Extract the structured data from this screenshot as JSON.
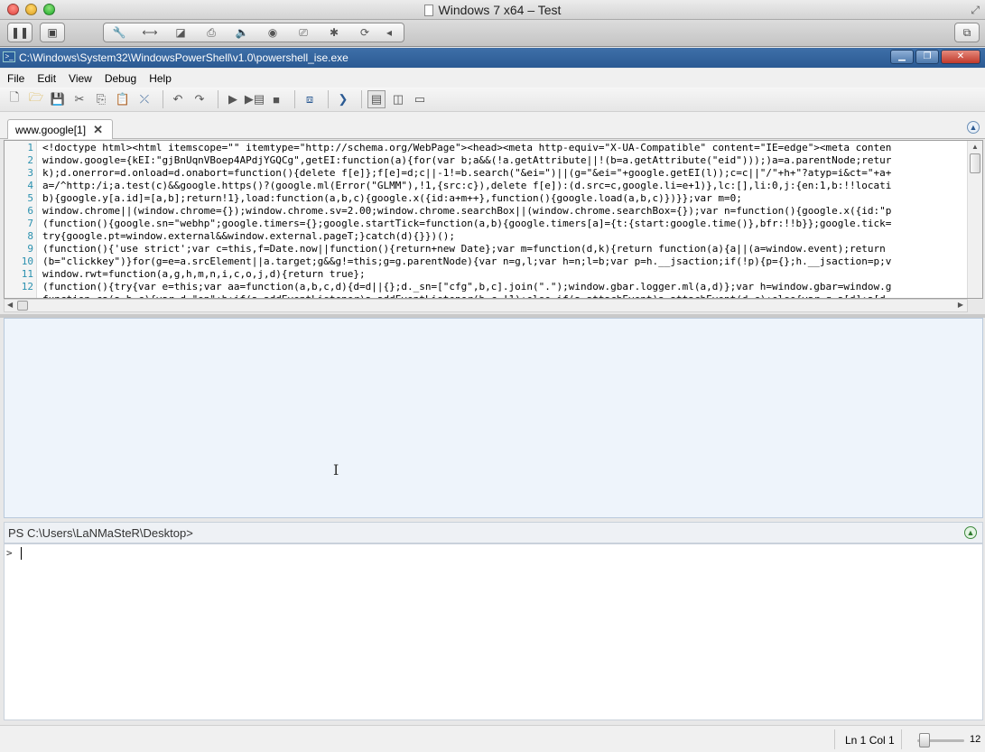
{
  "mac_window": {
    "title": "Windows 7 x64 – Test"
  },
  "vm_toolbar": {
    "pause_icon": "pause-icon",
    "snapshot_icon": "snapshot-icon",
    "icons": [
      "wrench-icon",
      "network-icon",
      "disk-icon",
      "printer-icon",
      "speaker-icon",
      "camera-icon",
      "usb-icon",
      "bluetooth-icon",
      "sync-icon",
      "chevron-left-icon"
    ],
    "fullscreen_icon": "fullscreen-icon"
  },
  "app_window": {
    "title": "C:\\Windows\\System32\\WindowsPowerShell\\v1.0\\powershell_ise.exe"
  },
  "menu": {
    "file": "File",
    "edit": "Edit",
    "view": "View",
    "debug": "Debug",
    "help": "Help"
  },
  "script_tabs": [
    {
      "label": "www.google[1]"
    }
  ],
  "editor": {
    "lines": [
      {
        "num": "1",
        "text": "<!doctype html><html itemscope=\"\" itemtype=\"http://schema.org/WebPage\"><head><meta http-equiv=\"X-UA-Compatible\" content=\"IE=edge\"><meta conten"
      },
      {
        "num": "2",
        "text": "window.google={kEI:\"gjBnUqnVBoep4APdjYGQCg\",getEI:function(a){for(var b;a&&(!a.getAttribute||!(b=a.getAttribute(\"eid\")));)a=a.parentNode;retur"
      },
      {
        "num": "3",
        "text": "k);d.onerror=d.onload=d.onabort=function(){delete f[e]};f[e]=d;c||-1!=b.search(\"&ei=\")||(g=\"&ei=\"+google.getEI(l));c=c||\"/\"+h+\"?atyp=i&ct=\"+a+"
      },
      {
        "num": "4",
        "text": "a=/^http:/i;a.test(c)&&google.https()?(google.ml(Error(\"GLMM\"),!1,{src:c}),delete f[e]):(d.src=c,google.li=e+1)},lc:[],li:0,j:{en:1,b:!!locati"
      },
      {
        "num": "5",
        "text": "b){google.y[a.id]=[a,b];return!1},load:function(a,b,c){google.x({id:a+m++},function(){google.load(a,b,c)})}};var m=0;"
      },
      {
        "num": "6",
        "text": "window.chrome||(window.chrome={});window.chrome.sv=2.00;window.chrome.searchBox||(window.chrome.searchBox={});var n=function(){google.x({id:\"p"
      },
      {
        "num": "7",
        "text": "(function(){google.sn=\"webhp\";google.timers={};google.startTick=function(a,b){google.timers[a]={t:{start:google.time()},bfr:!!b}};google.tick="
      },
      {
        "num": "8",
        "text": "try{google.pt=window.external&&window.external.pageT;}catch(d){}})();"
      },
      {
        "num": "9",
        "text": "(function(){'use strict';var c=this,f=Date.now||function(){return+new Date};var m=function(d,k){return function(a){a||(a=window.event);return "
      },
      {
        "num": "10",
        "text": "(b=\"clickkey\")}for(g=e=a.srcElement||a.target;g&&g!=this;g=g.parentNode){var n=g,l;var h=n;l=b;var p=h.__jsaction;if(!p){p={};h.__jsaction=p;v"
      },
      {
        "num": "11",
        "text": "window.rwt=function(a,g,h,m,n,i,c,o,j,d){return true};"
      },
      {
        "num": "12",
        "text": "(function(){try{var e=this;var aa=function(a,b,c,d){d=d||{};d._sn=[\"cfg\",b,c].join(\".\");window.gbar.logger.ml(a,d)};var h=window.gbar=window.g"
      },
      {
        "num": "",
        "text": "function ca(a,b,c){var d=\"on\"+b;if(a.addEventListener)a.addEventListener(b,c,!1);else if(a.attachEvent)a.attachEvent(d,c);else{var g=a[d];a[d"
      }
    ]
  },
  "command_pane": {
    "header": "PS C:\\Users\\LaNMaSteR\\Desktop>",
    "prompt": ">",
    "input": ""
  },
  "status_bar": {
    "position": "Ln 1  Col 1",
    "zoom": "12"
  }
}
